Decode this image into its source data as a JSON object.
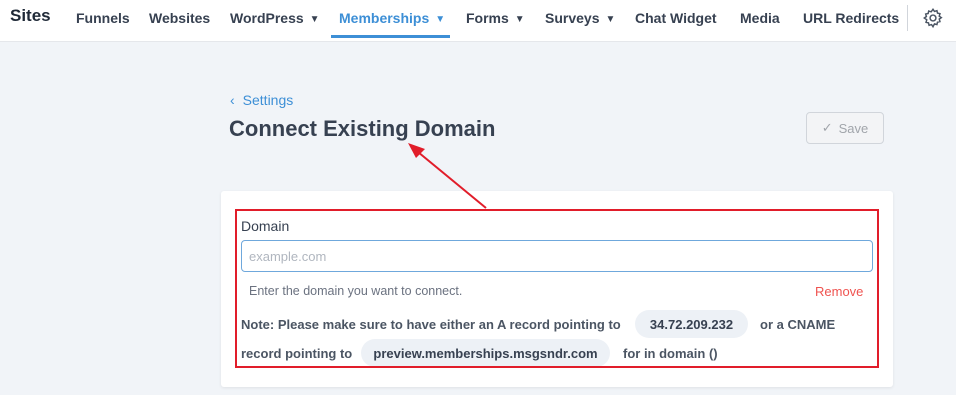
{
  "nav": {
    "brand": "Sites",
    "items": [
      {
        "label": "Funnels",
        "dropdown": false,
        "active": false
      },
      {
        "label": "Websites",
        "dropdown": false,
        "active": false
      },
      {
        "label": "WordPress",
        "dropdown": true,
        "active": false
      },
      {
        "label": "Memberships",
        "dropdown": true,
        "active": true
      },
      {
        "label": "Forms",
        "dropdown": true,
        "active": false
      },
      {
        "label": "Surveys",
        "dropdown": true,
        "active": false
      },
      {
        "label": "Chat Widget",
        "dropdown": false,
        "active": false
      },
      {
        "label": "Media",
        "dropdown": false,
        "active": false
      },
      {
        "label": "URL Redirects",
        "dropdown": false,
        "active": false
      }
    ],
    "settings_icon": "gear-icon"
  },
  "header": {
    "breadcrumb": "Settings",
    "title": "Connect Existing Domain",
    "save_label": "Save"
  },
  "form": {
    "label": "Domain",
    "input_value": "",
    "placeholder": "example.com",
    "help_text": "Enter the domain you want to connect.",
    "remove_label": "Remove",
    "note": {
      "part1": "Note: Please make sure to have either an A record pointing to",
      "ip": "34.72.209.232",
      "part2": "or a CNAME",
      "part3": "record pointing to",
      "cname": "preview.memberships.msgsndr.com",
      "part4": "for in domain ()"
    }
  },
  "colors": {
    "accent": "#3d8fd6",
    "annotation": "#e11d2a",
    "danger": "#ef5350"
  }
}
